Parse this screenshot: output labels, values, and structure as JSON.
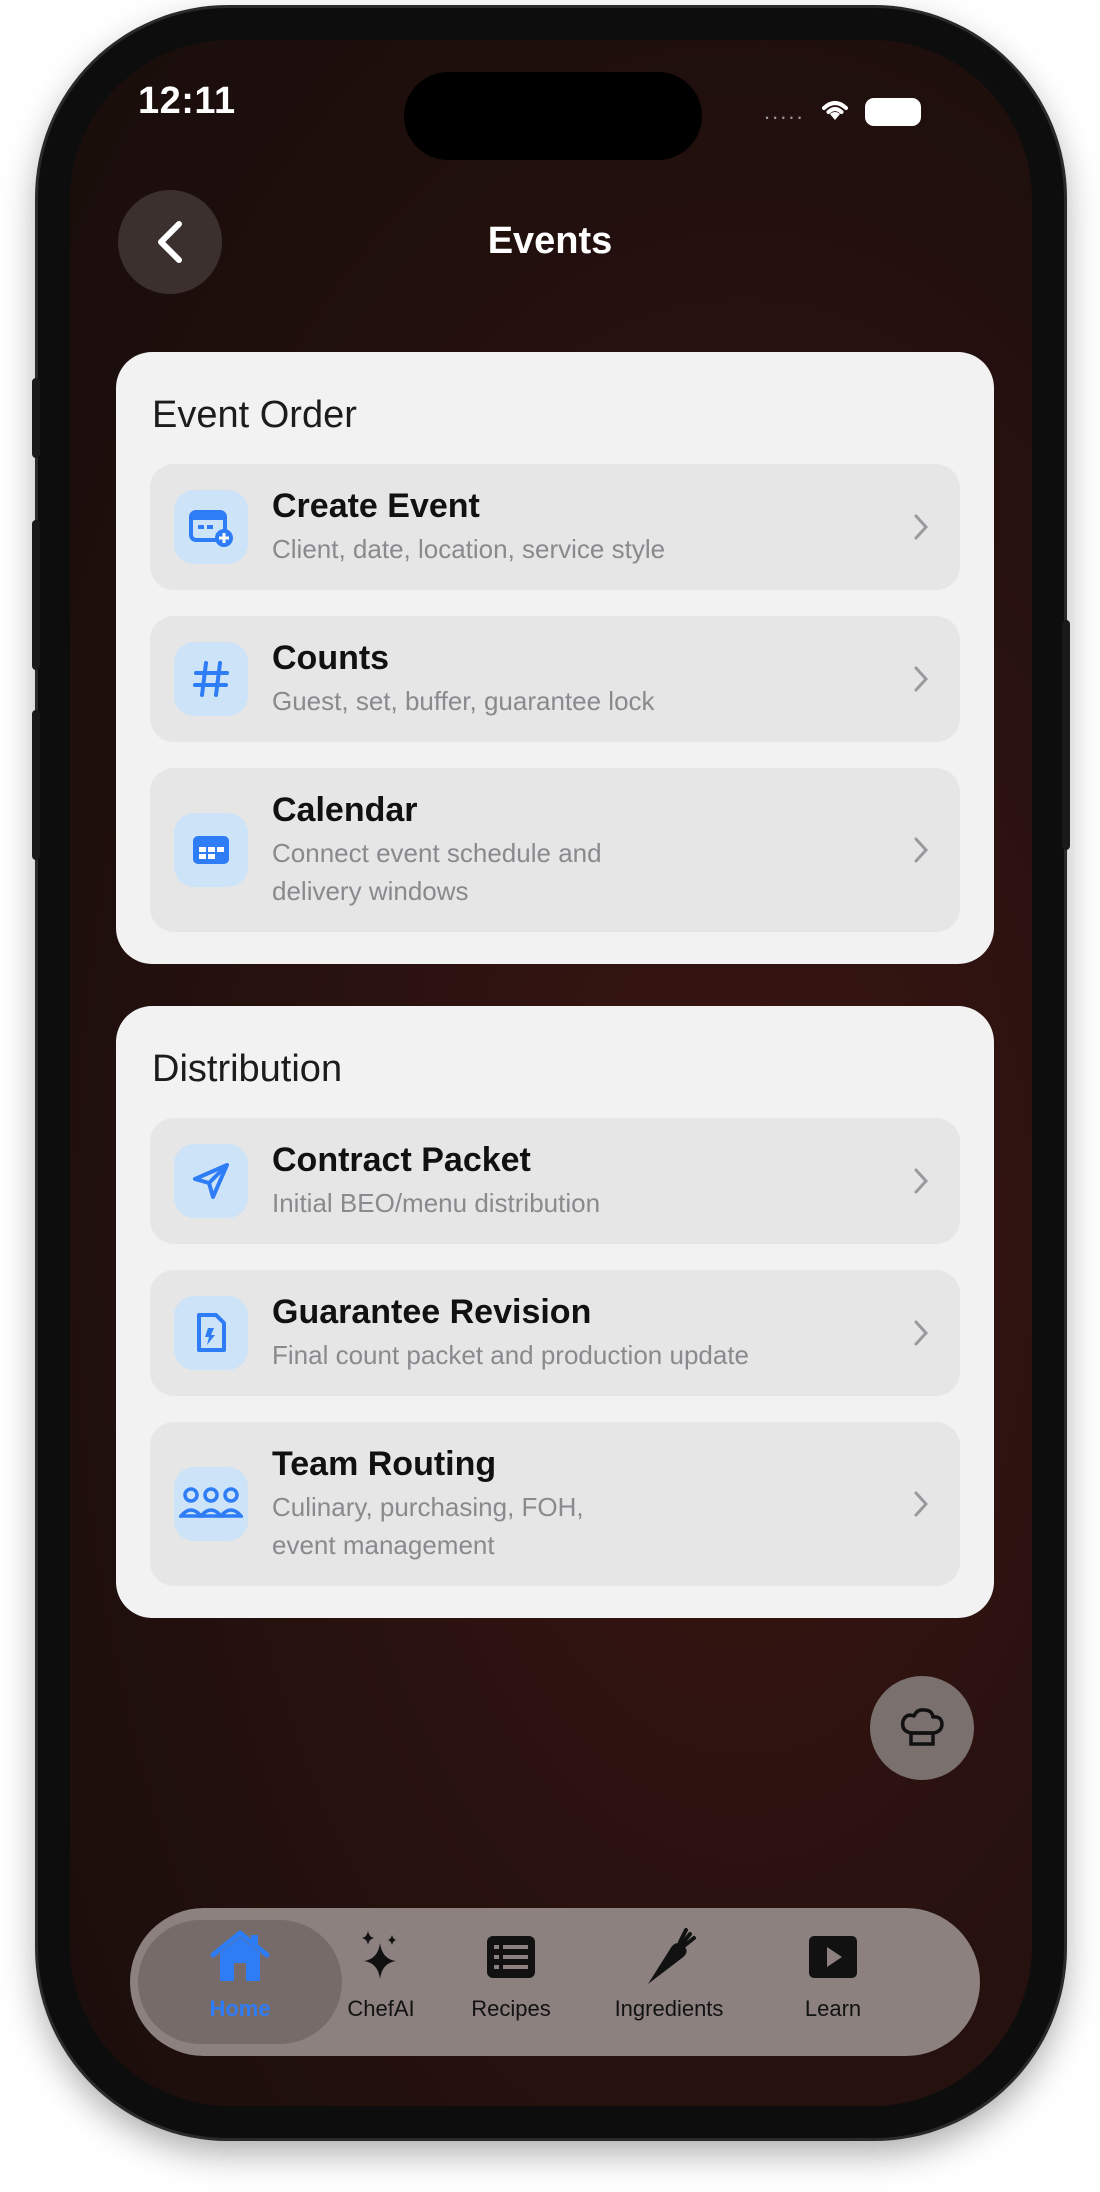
{
  "status_bar": {
    "time": "12:11",
    "signal_dots": "....."
  },
  "header": {
    "title": "Events"
  },
  "sections": [
    {
      "title": "Event Order",
      "items": [
        {
          "title": "Create Event",
          "subtitle_lines": [
            "Client, date, location, service style"
          ],
          "icon": "calendar-plus-icon"
        },
        {
          "title": "Counts",
          "subtitle_lines": [
            "Guest, set, buffer, guarantee lock"
          ],
          "icon": "hash-icon"
        },
        {
          "title": "Calendar",
          "subtitle_lines": [
            "Connect event schedule and",
            "delivery windows"
          ],
          "icon": "calendar-icon"
        }
      ]
    },
    {
      "title": "Distribution",
      "items": [
        {
          "title": "Contract Packet",
          "subtitle_lines": [
            "Initial BEO/menu distribution"
          ],
          "icon": "paper-plane-icon"
        },
        {
          "title": "Guarantee Revision",
          "subtitle_lines": [
            "Final count packet and production update"
          ],
          "icon": "document-icon"
        },
        {
          "title": "Team Routing",
          "subtitle_lines": [
            "Culinary, purchasing, FOH,",
            "event management"
          ],
          "icon": "team-icon"
        }
      ]
    }
  ],
  "tabbar": {
    "tabs": [
      {
        "label": "Home",
        "icon": "house-icon",
        "active": true
      },
      {
        "label": "ChefAI",
        "icon": "sparkles-icon",
        "active": false
      },
      {
        "label": "Recipes",
        "icon": "list-icon",
        "active": false
      },
      {
        "label": "Ingredients",
        "icon": "carrot-icon",
        "active": false
      },
      {
        "label": "Learn",
        "icon": "play-icon",
        "active": false
      }
    ]
  },
  "colors": {
    "accent": "#2e7cf6",
    "icon_bg": "#cde3f7",
    "card": "#f2f2f2",
    "row": "#e6e6e6"
  }
}
